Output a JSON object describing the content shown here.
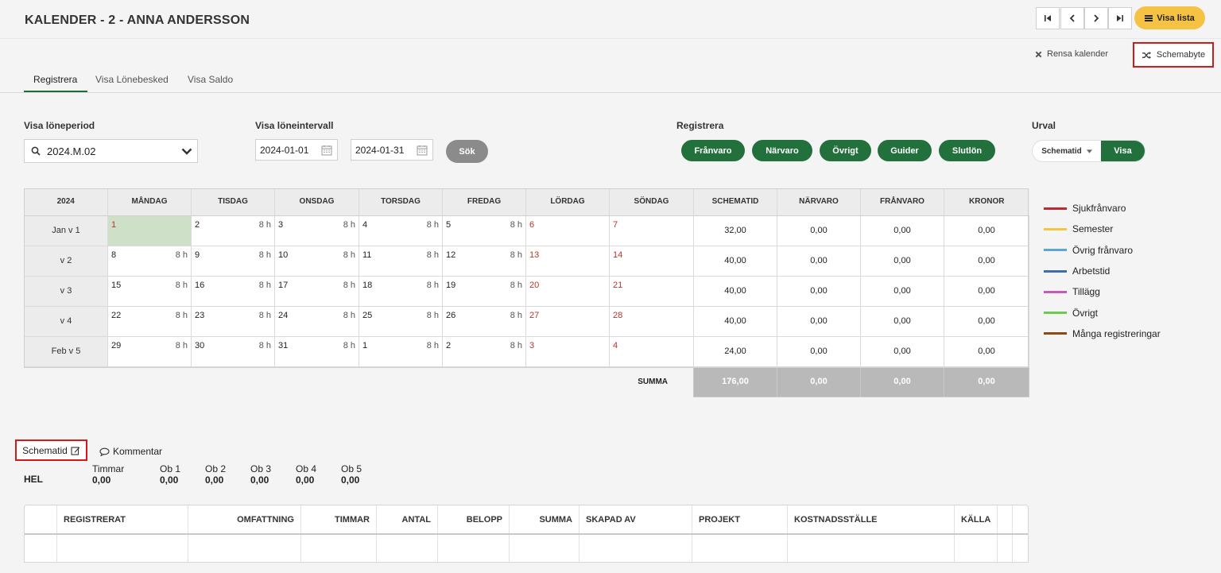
{
  "header": {
    "title": "KALENDER - 2 - ANNA ANDERSSON",
    "visa_lista": "Visa lista",
    "rensa_kalender": "Rensa kalender",
    "schemabyte": "Schemabyte"
  },
  "tabs": [
    {
      "label": "Registrera"
    },
    {
      "label": "Visa Lönebesked"
    },
    {
      "label": "Visa Saldo"
    }
  ],
  "filters": {
    "period_label": "Visa löneperiod",
    "period_value": "2024.M.02",
    "interval_label": "Visa löneintervall",
    "date_from": "2024-01-01",
    "date_to": "2024-01-31",
    "search": "Sök",
    "registrera_label": "Registrera",
    "registrera_buttons": [
      "Frånvaro",
      "Närvaro",
      "Övrigt",
      "Guider",
      "Slutlön"
    ],
    "urval_label": "Urval",
    "urval_value": "Schematid",
    "urval_visa": "Visa"
  },
  "calendar": {
    "headers": [
      "2024",
      "MÅNDAG",
      "TISDAG",
      "ONSDAG",
      "TORSDAG",
      "FREDAG",
      "LÖRDAG",
      "SÖNDAG",
      "SCHEMATID",
      "NÄRVARO",
      "FRÅNVARO",
      "KRONOR"
    ],
    "rows": [
      {
        "week": "Jan v 1",
        "days": [
          {
            "d": "1",
            "h": ""
          },
          {
            "d": "2",
            "h": "8 h"
          },
          {
            "d": "3",
            "h": "8 h"
          },
          {
            "d": "4",
            "h": "8 h"
          },
          {
            "d": "5",
            "h": "8 h"
          },
          {
            "d": "6",
            "h": ""
          },
          {
            "d": "7",
            "h": ""
          }
        ],
        "schematid": "32,00",
        "narvaro": "0,00",
        "franvaro": "0,00",
        "kronor": "0,00"
      },
      {
        "week": "v 2",
        "days": [
          {
            "d": "8",
            "h": "8 h"
          },
          {
            "d": "9",
            "h": "8 h"
          },
          {
            "d": "10",
            "h": "8 h"
          },
          {
            "d": "11",
            "h": "8 h"
          },
          {
            "d": "12",
            "h": "8 h"
          },
          {
            "d": "13",
            "h": ""
          },
          {
            "d": "14",
            "h": ""
          }
        ],
        "schematid": "40,00",
        "narvaro": "0,00",
        "franvaro": "0,00",
        "kronor": "0,00"
      },
      {
        "week": "v 3",
        "days": [
          {
            "d": "15",
            "h": "8 h"
          },
          {
            "d": "16",
            "h": "8 h"
          },
          {
            "d": "17",
            "h": "8 h"
          },
          {
            "d": "18",
            "h": "8 h"
          },
          {
            "d": "19",
            "h": "8 h"
          },
          {
            "d": "20",
            "h": ""
          },
          {
            "d": "21",
            "h": ""
          }
        ],
        "schematid": "40,00",
        "narvaro": "0,00",
        "franvaro": "0,00",
        "kronor": "0,00"
      },
      {
        "week": "v 4",
        "days": [
          {
            "d": "22",
            "h": "8 h"
          },
          {
            "d": "23",
            "h": "8 h"
          },
          {
            "d": "24",
            "h": "8 h"
          },
          {
            "d": "25",
            "h": "8 h"
          },
          {
            "d": "26",
            "h": "8 h"
          },
          {
            "d": "27",
            "h": ""
          },
          {
            "d": "28",
            "h": ""
          }
        ],
        "schematid": "40,00",
        "narvaro": "0,00",
        "franvaro": "0,00",
        "kronor": "0,00"
      },
      {
        "week": "Feb v 5",
        "days": [
          {
            "d": "29",
            "h": "8 h"
          },
          {
            "d": "30",
            "h": "8 h"
          },
          {
            "d": "31",
            "h": "8 h"
          },
          {
            "d": "1",
            "h": "8 h"
          },
          {
            "d": "2",
            "h": "8 h"
          },
          {
            "d": "3",
            "h": ""
          },
          {
            "d": "4",
            "h": ""
          }
        ],
        "schematid": "24,00",
        "narvaro": "0,00",
        "franvaro": "0,00",
        "kronor": "0,00"
      }
    ],
    "summa_label": "SUMMA",
    "summa": {
      "schematid": "176,00",
      "narvaro": "0,00",
      "franvaro": "0,00",
      "kronor": "0,00"
    }
  },
  "legend": [
    {
      "label": "Sjukfrånvaro",
      "color": "#c8252c"
    },
    {
      "label": "Semester",
      "color": "#f4c543"
    },
    {
      "label": "Övrig frånvaro",
      "color": "#5aa6dc"
    },
    {
      "label": "Arbetstid",
      "color": "#3f6ea8"
    },
    {
      "label": "Tillägg",
      "color": "#c75ab9"
    },
    {
      "label": "Övrigt",
      "color": "#6ccb4b"
    },
    {
      "label": "Många registreringar",
      "color": "#8b4a16"
    }
  ],
  "summary": {
    "schematid_label": "Schematid",
    "kommentar_label": "Kommentar",
    "row_label": "HEL",
    "columns": [
      {
        "label": "Timmar",
        "value": "0,00"
      },
      {
        "label": "Ob 1",
        "value": "0,00"
      },
      {
        "label": "Ob 2",
        "value": "0,00"
      },
      {
        "label": "Ob 3",
        "value": "0,00"
      },
      {
        "label": "Ob 4",
        "value": "0,00"
      },
      {
        "label": "Ob 5",
        "value": "0,00"
      }
    ]
  },
  "registrations": {
    "headers": [
      "REGISTRERAT",
      "OMFATTNING",
      "TIMMAR",
      "ANTAL",
      "BELOPP",
      "SUMMA",
      "SKAPAD AV",
      "PROJEKT",
      "KOSTNADSSTÄLLE",
      "KÄLLA"
    ]
  },
  "colors": {
    "accent_green": "#22713d",
    "yellow": "#f5c243",
    "highlight_red": "#d21a1a"
  }
}
